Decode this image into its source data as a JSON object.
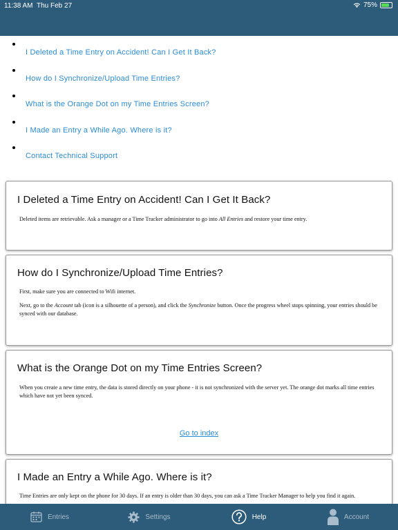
{
  "status_bar": {
    "time": "11:38 AM",
    "date": "Thu Feb 27",
    "battery": "75%",
    "battery_level": 0.75
  },
  "index": {
    "items": [
      "I Deleted a Time Entry on Accident! Can I Get It Back?",
      "How do I Synchronize/Upload Time Entries?",
      "What is the Orange Dot on my Time Entries Screen?",
      "I Made an Entry a While Ago. Where is it?",
      "Contact Technical Support"
    ]
  },
  "sections": {
    "deleted": {
      "title": "I Deleted a Time Entry on Accident! Can I Get It Back?",
      "p1_before": "Deleted items are retrievable. Ask a manager or a Time Tracker administrator to go into ",
      "p1_em": "All Entries",
      "p1_after": " and restore your time entry."
    },
    "sync": {
      "title": "How do I Synchronize/Upload Time Entries?",
      "p1": "First, make sure you are connected to Wifi internet.",
      "p2_a": "Next, go to the ",
      "p2_em1": "Account",
      "p2_b": " tab (icon is a silhouette of a person), and click the ",
      "p2_em2": "Synchronize",
      "p2_c": " button. Once the progress wheel stops spinning, your entries should be synced with our database."
    },
    "orange_dot": {
      "title": "What is the Orange Dot on my Time Entries Screen?",
      "p1": "When you create a new time entry, the data is stored directly on your phone - it is not synchronized with the server yet. The orange dot marks all time entries which have not yet been synced.",
      "goto": "Go to index"
    },
    "entry_ago": {
      "title": "I Made an Entry a While Ago. Where is it?",
      "p1": "Time Entries are only kept on the phone for 30 days. If an entry is older than 30 days, you can ask a Time Tracker Manager to help you find it again."
    }
  },
  "tabbar": {
    "tabs": [
      {
        "label": "Entries",
        "icon": "calendar-icon",
        "active": false
      },
      {
        "label": "Settings",
        "icon": "gear-icon",
        "active": false
      },
      {
        "label": "Help",
        "icon": "question-circle-icon",
        "active": true
      },
      {
        "label": "Account",
        "icon": "person-icon",
        "active": false
      }
    ]
  },
  "colors": {
    "bar": "#2d5b7a",
    "link": "#2a8bd8",
    "tab_inactive": "#a9bccb",
    "tab_active": "#ffffff"
  }
}
